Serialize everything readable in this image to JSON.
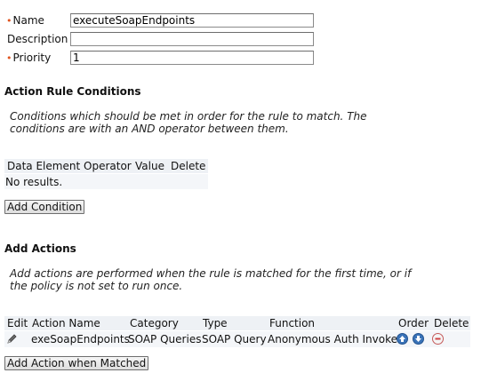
{
  "form": {
    "name_label": "Name",
    "name_value": "executeSoapEndpoints",
    "description_label": "Description",
    "description_value": "",
    "priority_label": "Priority",
    "priority_value": "1",
    "required_marker": "•"
  },
  "conditions": {
    "title": "Action Rule Conditions",
    "description": "Conditions which should be met in order for the rule to match. The conditions are with an AND operator between them.",
    "columns": [
      "Data Element",
      "Operator",
      "Value",
      "Delete"
    ],
    "empty_text": "No results.",
    "add_button": "Add Condition"
  },
  "actions": {
    "title": "Add Actions",
    "description": "Add actions are performed when the rule is matched for the first time, or if the policy is not set to run once.",
    "columns": [
      "Edit",
      "Action Name",
      "Category",
      "Type",
      "Function",
      "Order",
      "Delete"
    ],
    "rows": [
      {
        "edit_icon": "pencil-icon",
        "name": "exeSoapEndpoints",
        "category": "SOAP Queries",
        "type": "SOAP Query",
        "function": "Anonymous Auth Invoke",
        "order_icons": [
          "arrow-up-icon",
          "arrow-down-icon"
        ],
        "delete_icon": "minus-circle-icon"
      }
    ],
    "add_button": "Add Action when Matched"
  },
  "colors": {
    "required": "#e0541f",
    "grid_header_bg": "#eef1f5",
    "order_icon_blue": "#3a73b8",
    "delete_icon_red": "#d04444"
  }
}
